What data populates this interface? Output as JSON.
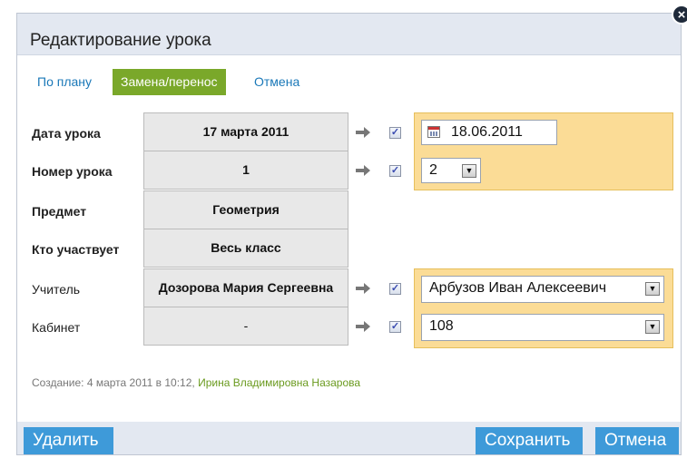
{
  "dialog": {
    "title": "Редактирование урока"
  },
  "tabs": [
    {
      "label": "По плану",
      "active": false
    },
    {
      "label": "Замена/перенос",
      "active": true
    },
    {
      "label": "Отмена",
      "active": false
    }
  ],
  "rows": [
    {
      "label": "Дата урока",
      "original": "17 марта 2011",
      "checked": true,
      "new_value": "18.06.2011",
      "control": "date"
    },
    {
      "label": "Номер урока",
      "original": "1",
      "checked": true,
      "new_value": "2",
      "control": "select"
    },
    {
      "label": "Предмет",
      "original": "Геометрия"
    },
    {
      "label": "Кто участвует",
      "original": "Весь класс"
    },
    {
      "label": "Учитель",
      "original": "Дозорова Мария Сергеевна",
      "checked": true,
      "new_value": "Арбузов Иван Алексеевич",
      "control": "select"
    },
    {
      "label": "Кабинет",
      "original": "-",
      "checked": true,
      "new_value": "108",
      "control": "select"
    }
  ],
  "meta": {
    "created_label": "Создание:",
    "created_at": "4 марта 2011 в 10:12,",
    "author": "Ирина Владимировна Назарова"
  },
  "footer": {
    "delete_label": "Удалить",
    "save_label": "Сохранить",
    "cancel_label": "Отмена"
  },
  "colors": {
    "accent": "#7aa82a",
    "button": "#3e9ad9",
    "highlight": "#fbdc96",
    "link": "#1a78b8"
  },
  "icons": {
    "close": "close-icon",
    "arrow": "arrow-right-icon",
    "calendar": "calendar-icon",
    "dropdown": "chevron-down-icon"
  }
}
